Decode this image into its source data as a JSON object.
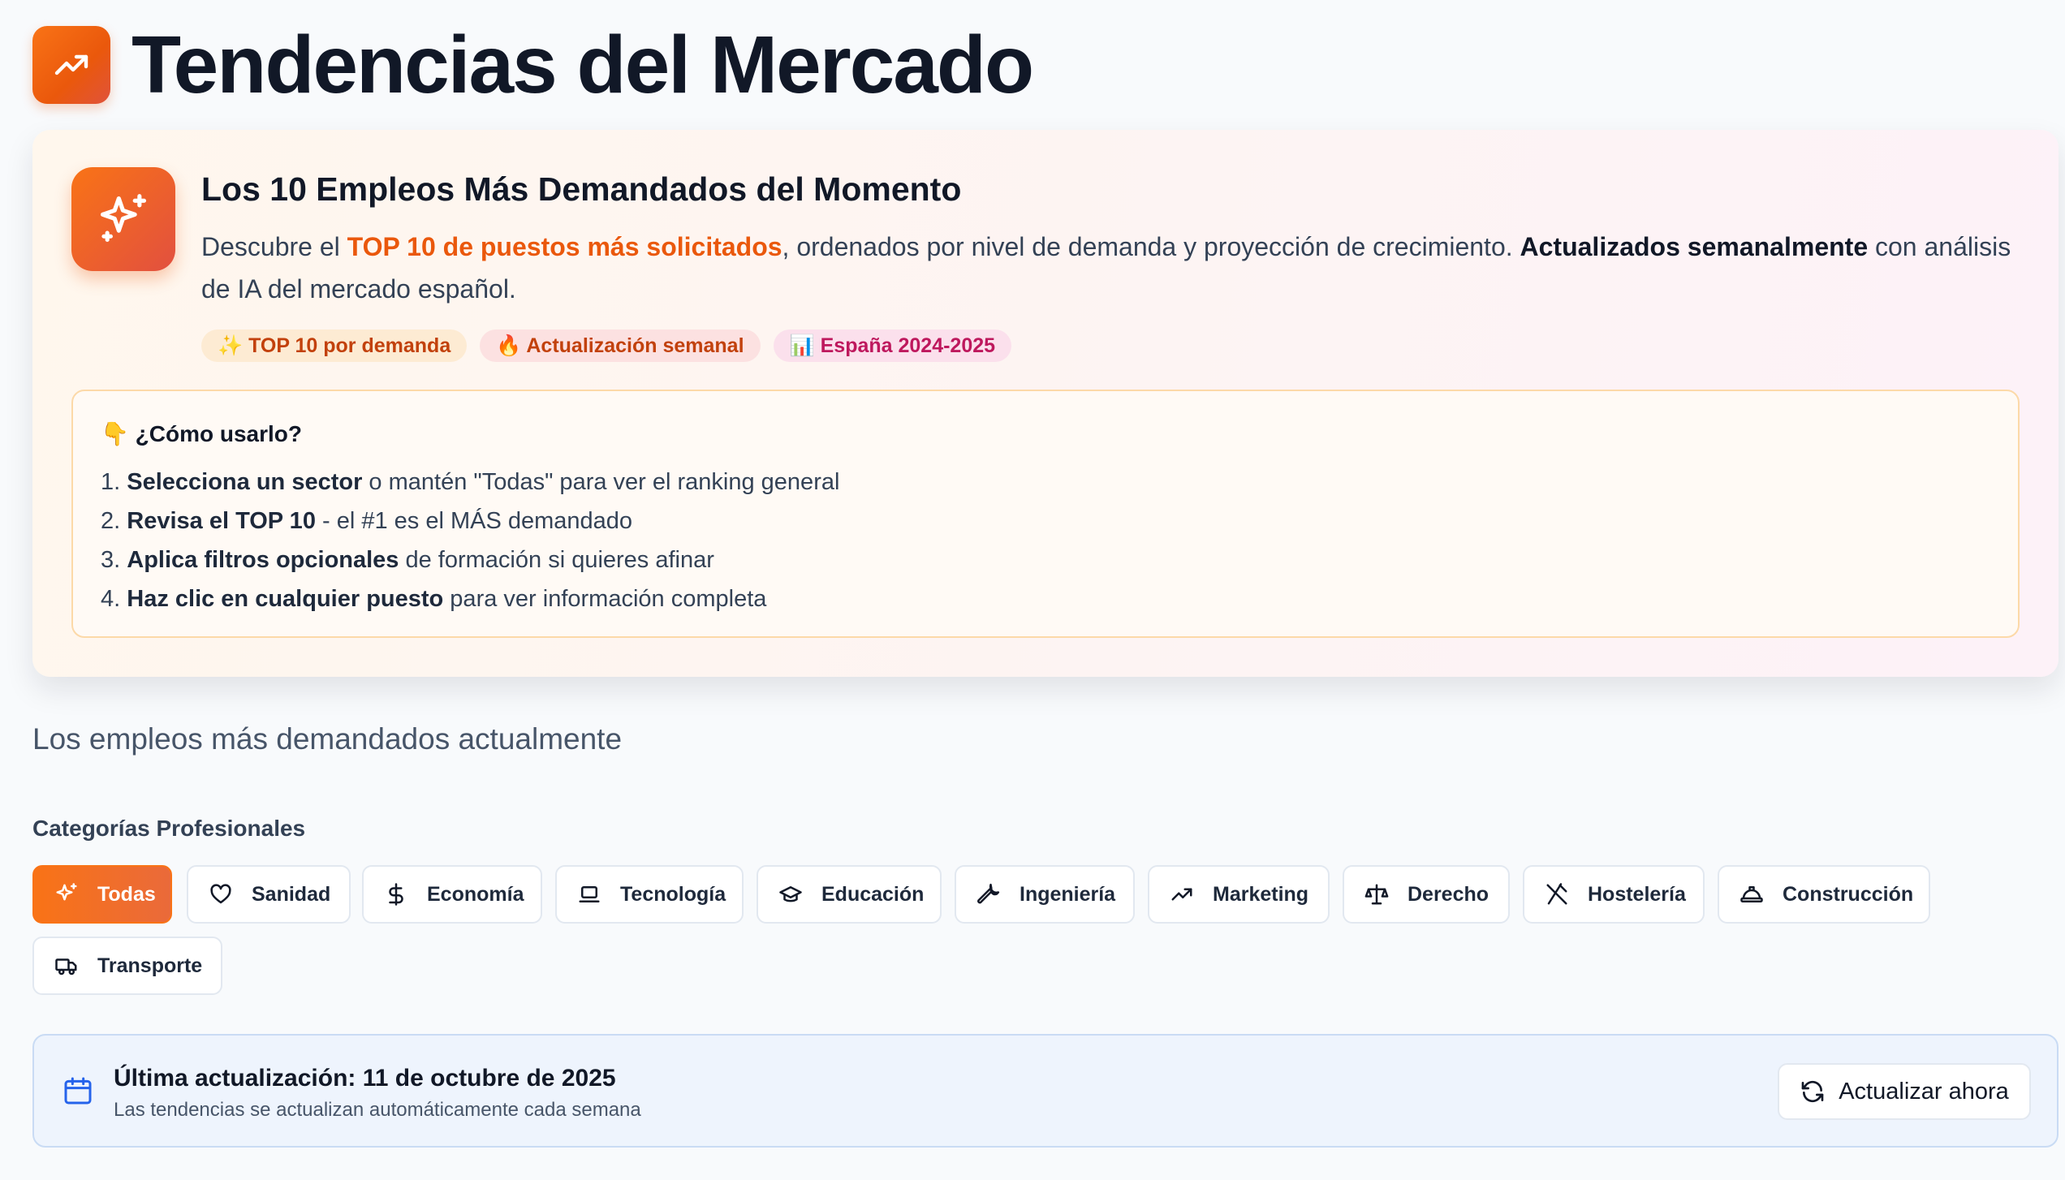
{
  "header": {
    "title": "Tendencias del Mercado",
    "icon": "trending-up-icon"
  },
  "hero": {
    "title": "Los 10 Empleos Más Demandados del Momento",
    "desc_1": "Descubre el ",
    "desc_accent": "TOP 10 de puestos más solicitados",
    "desc_2": ", ordenados por nivel de demanda y proyección de crecimiento. ",
    "desc_strong": "Actualizados semanalmente",
    "desc_3": " con análisis de IA del mercado español.",
    "chips": [
      "✨ TOP 10 por demanda",
      "🔥 Actualización semanal",
      "📊 España 2024-2025"
    ],
    "howto": {
      "title": "👇 ¿Cómo usarlo?",
      "steps": [
        {
          "num": "1. ",
          "bold": "Selecciona un sector",
          "rest": " o mantén \"Todas\" para ver el ranking general"
        },
        {
          "num": "2. ",
          "bold": "Revisa el TOP 10",
          "rest": " - el #1 es el MÁS demandado"
        },
        {
          "num": "3. ",
          "bold": "Aplica filtros opcionales",
          "rest": " de formación si quieres afinar"
        },
        {
          "num": "4. ",
          "bold": "Haz clic en cualquier puesto",
          "rest": " para ver información completa"
        }
      ]
    }
  },
  "subtitle": "Los empleos más demandados actualmente",
  "categories": {
    "title": "Categorías Profesionales",
    "items": [
      {
        "label": "Todas",
        "icon": "sparkles-icon",
        "active": true
      },
      {
        "label": "Sanidad",
        "icon": "heart-icon"
      },
      {
        "label": "Economía",
        "icon": "dollar-icon"
      },
      {
        "label": "Tecnología",
        "icon": "laptop-icon"
      },
      {
        "label": "Educación",
        "icon": "graduation-cap-icon"
      },
      {
        "label": "Ingeniería",
        "icon": "wrench-icon"
      },
      {
        "label": "Marketing",
        "icon": "trending-up-icon"
      },
      {
        "label": "Derecho",
        "icon": "scale-icon"
      },
      {
        "label": "Hostelería",
        "icon": "utensils-crossed-icon"
      },
      {
        "label": "Construcción",
        "icon": "hard-hat-icon"
      },
      {
        "label": "Transporte",
        "icon": "truck-icon"
      }
    ]
  },
  "update": {
    "title": "Última actualización: 11 de octubre de 2025",
    "subtitle": "Las tendencias se actualizan automáticamente cada semana",
    "button_label": "Actualizar ahora"
  },
  "colors": {
    "accent": "#f97316",
    "accent_dark": "#ea580c",
    "pink": "#be185d",
    "info_bg": "#eef4fd"
  }
}
